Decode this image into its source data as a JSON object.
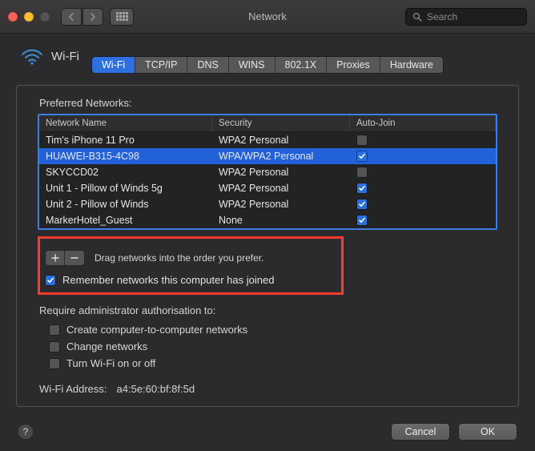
{
  "window": {
    "title": "Network",
    "search_placeholder": "Search"
  },
  "header": {
    "icon": "wifi-icon",
    "label": "Wi-Fi"
  },
  "tabs": [
    {
      "label": "Wi-Fi",
      "active": true
    },
    {
      "label": "TCP/IP",
      "active": false
    },
    {
      "label": "DNS",
      "active": false
    },
    {
      "label": "WINS",
      "active": false
    },
    {
      "label": "802.1X",
      "active": false
    },
    {
      "label": "Proxies",
      "active": false
    },
    {
      "label": "Hardware",
      "active": false
    }
  ],
  "section": {
    "preferred_label": "Preferred Networks:",
    "columns": {
      "name": "Network Name",
      "security": "Security",
      "autojoin": "Auto-Join"
    },
    "rows": [
      {
        "name": "Tim's iPhone 11 Pro",
        "security": "WPA2 Personal",
        "auto_join": false,
        "selected": false
      },
      {
        "name": "HUAWEI-B315-4C98",
        "security": "WPA/WPA2 Personal",
        "auto_join": true,
        "selected": true
      },
      {
        "name": "SKYCCD02",
        "security": "WPA2 Personal",
        "auto_join": false,
        "selected": false
      },
      {
        "name": "Unit 1 - Pillow of Winds 5g",
        "security": "WPA2 Personal",
        "auto_join": true,
        "selected": false
      },
      {
        "name": "Unit 2 - Pillow of Winds",
        "security": "WPA2 Personal",
        "auto_join": true,
        "selected": false
      },
      {
        "name": "MarkerHotel_Guest",
        "security": "None",
        "auto_join": true,
        "selected": false
      }
    ],
    "drag_hint": "Drag networks into the order you prefer.",
    "remember_label": "Remember networks this computer has joined",
    "remember_checked": true,
    "admin_label": "Require administrator authorisation to:",
    "admin_opts": [
      {
        "label": "Create computer-to-computer networks",
        "checked": false
      },
      {
        "label": "Change networks",
        "checked": false
      },
      {
        "label": "Turn Wi-Fi on or off",
        "checked": false
      }
    ],
    "wifi_address_label": "Wi-Fi Address:",
    "wifi_address_value": "a4:5e:60:bf:8f:5d"
  },
  "footer": {
    "cancel": "Cancel",
    "ok": "OK"
  }
}
